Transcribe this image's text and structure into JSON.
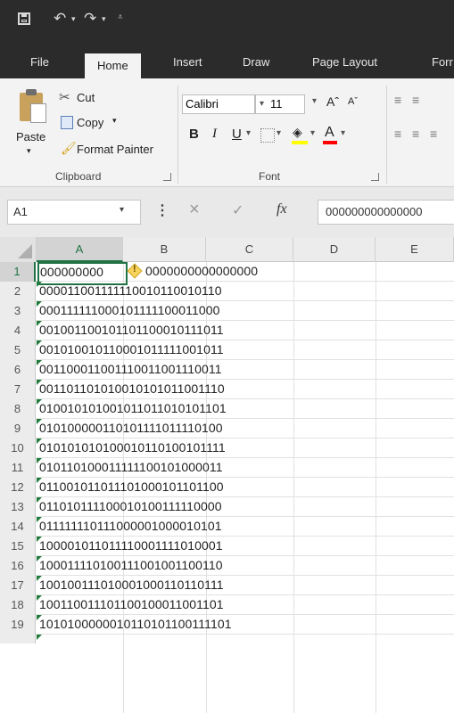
{
  "ribbon_tabs": {
    "file": "File",
    "home": "Home",
    "insert": "Insert",
    "draw": "Draw",
    "page_layout": "Page Layout",
    "formulas": "Forr"
  },
  "clipboard": {
    "cut": "Cut",
    "copy": "Copy",
    "copy_arrow": "▾",
    "format_painter": "Format Painter",
    "paste": "Paste",
    "group_label": "Clipboard"
  },
  "font": {
    "name": "Calibri",
    "size": "11",
    "bold": "B",
    "italic": "I",
    "underline": "U",
    "group_label": "Font"
  },
  "formula_bar": {
    "name_box": "A1",
    "cancel": "×",
    "enter": "✓",
    "fx": "fx",
    "content": "000000000000000"
  },
  "columns": [
    "A",
    "B",
    "C",
    "D",
    "E"
  ],
  "rows": [
    {
      "n": "1",
      "v": "000000000",
      "v2": "0000000000000000"
    },
    {
      "n": "2",
      "v": "00001100111111001011001011 0"
    },
    {
      "n": "3",
      "v": "00011111100010111110001100 0"
    },
    {
      "n": "4",
      "v": "00100110010110110001011101 1"
    },
    {
      "n": "5",
      "v": "00101001011000101111100101 1"
    },
    {
      "n": "6",
      "v": "00110001100111001100111001 1"
    },
    {
      "n": "7",
      "v": "00110110101001010101100111 0"
    },
    {
      "n": "8",
      "v": "01001010100101101101010110 1"
    },
    {
      "n": "9",
      "v": "01010000011010111101111010 0"
    },
    {
      "n": "10",
      "v": "01010101010001011010010111 1"
    },
    {
      "n": "11",
      "v": "01011010001111110010100001 1"
    },
    {
      "n": "12",
      "v": "01100101101110100010110110 0"
    },
    {
      "n": "13",
      "v": "01101011110001010011111000 0"
    },
    {
      "n": "14",
      "v": "01111111011100000100001010 1"
    },
    {
      "n": "15",
      "v": "10000101101111000111101000 1"
    },
    {
      "n": "16",
      "v": "10001111010011100100110011 0"
    },
    {
      "n": "17",
      "v": "10010011101000100011011011 1"
    },
    {
      "n": "18",
      "v": "10011001110110010001100110 1"
    },
    {
      "n": "19",
      "v": "10101000000101101011001111 01"
    }
  ],
  "accent_color": "#217346"
}
